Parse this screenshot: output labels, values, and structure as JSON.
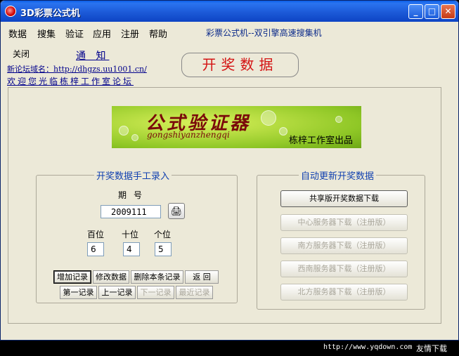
{
  "window": {
    "title": "3D彩票公式机",
    "min_glyph": "_",
    "max_glyph": "□",
    "close_glyph": "✕"
  },
  "menu": {
    "items": [
      "数据",
      "搜集",
      "验证",
      "应用",
      "注册",
      "帮助"
    ],
    "slogan": "彩票公式机--双引擎高速搜集机"
  },
  "top": {
    "close_label": "关闭",
    "notice_link": "通 知",
    "domain_link": "新论坛域名：http://dhgzs.uu1001.cn/",
    "welcome_link": "欢迎您光临栋梓工作室论坛",
    "header": "开奖数据"
  },
  "banner": {
    "title": "公式验证器",
    "pinyin": "gongshiyanzhengqi",
    "credit": "栋梓工作室出品"
  },
  "manual": {
    "title": "开奖数据手工录入",
    "issue_label": "期号",
    "issue_value": "2009111",
    "print_icon": "🖨",
    "digit_labels": [
      "百位",
      "十位",
      "个位"
    ],
    "digit_values": [
      "6",
      "4",
      "5"
    ],
    "buttons_row1": [
      "增加记录",
      "修改数据",
      "删除本条记录",
      "返 回"
    ],
    "buttons_row2": [
      "第一记录",
      "上一记录",
      "下一记录",
      "最近记录"
    ]
  },
  "auto": {
    "title": "自动更新开奖数据",
    "buttons": [
      "共享版开奖数据下载",
      "中心服务器下载（注册版）",
      "南方服务器下载（注册版）",
      "西南服务器下载（注册版）",
      "北方服务器下载（注册版）"
    ]
  },
  "footer": {
    "url": "http://www.yqdown.com",
    "site": "友情下载"
  },
  "colors": {
    "titlebar": "#1c5ad8",
    "header_text": "#d41414",
    "link": "#00008b",
    "group_title": "#1040b0"
  }
}
